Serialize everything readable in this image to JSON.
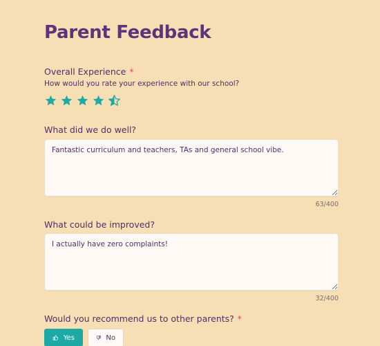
{
  "page": {
    "title": "Parent Feedback"
  },
  "experience": {
    "label": "Overall Experience",
    "required_mark": "*",
    "question": "How would you rate your experience with our school?",
    "rating": 4.5,
    "max_rating": 5,
    "star_color": "#1fa9a4"
  },
  "did_well": {
    "label": "What did we do well?",
    "value": "Fantastic curriculum and teachers, TAs and general school vibe.",
    "counter": "63/400"
  },
  "improve": {
    "label": "What could be improved?",
    "value": "I actually have zero complaints!",
    "counter": "32/400"
  },
  "recommend": {
    "label": "Would you recommend us to other parents?",
    "required_mark": "*",
    "yes_label": "Yes",
    "no_label": "No",
    "selected": "Yes",
    "yes_icon": "thumbs-up-icon",
    "no_icon": "thumbs-down-icon"
  }
}
